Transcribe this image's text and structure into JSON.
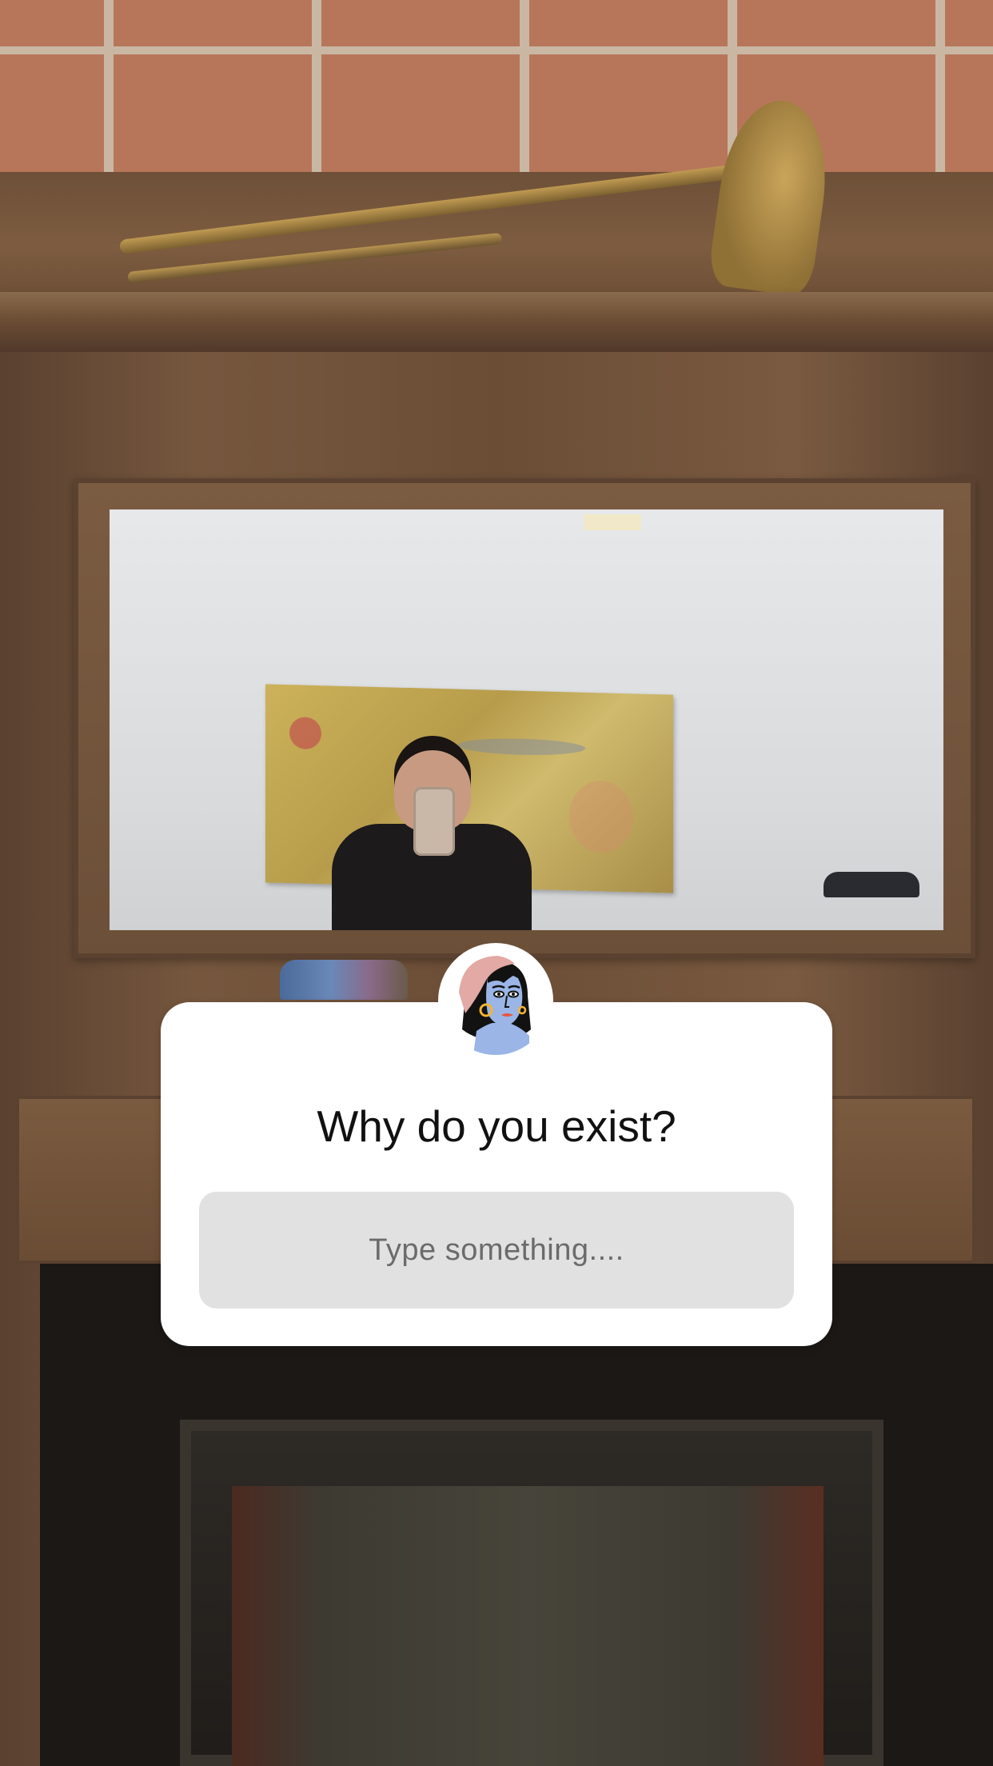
{
  "question_sticker": {
    "question": "Why do you exist?",
    "answer_placeholder": "Type something....",
    "avatar_icon": "illustrated-portrait-avatar-icon"
  },
  "colors": {
    "sticker_background": "#ffffff",
    "answer_field_background": "#e1e1e1",
    "placeholder_text": "#6b6b6b",
    "question_text": "#111111"
  }
}
